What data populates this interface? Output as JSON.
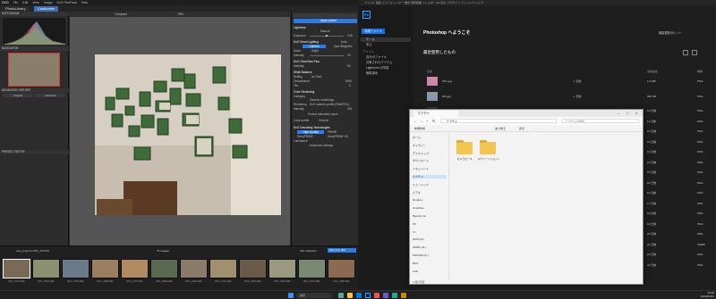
{
  "dxo": {
    "window_title": "DXO",
    "menu": [
      "File",
      "Edit",
      "View",
      "Image",
      "DxO FilmPack",
      "Help"
    ],
    "tabs": {
      "library": "PhotoLibrary",
      "customize": "Customize"
    },
    "left": {
      "histogram": "HISTOGRAM",
      "navigator": "NAVIGATOR",
      "advanced_history": "ADVANCED HISTORY",
      "preset_editor": "PRESET EDITOR",
      "nav_buttons": [
        "Original",
        "Corrected"
      ]
    },
    "viewer": {
      "compare": "Compare",
      "zoom": "75%"
    },
    "right": {
      "search": "Search",
      "lightness": "Lightness",
      "dropdown_manual": "Manual",
      "exposure": "Exposure",
      "exposure_val": "0.00",
      "smart_lighting": "DxO Smart Lighting",
      "auto": "Auto",
      "uniform": "Uniform",
      "spot": "Spot Weighted",
      "mode": "Mode",
      "mode_val": "Slight",
      "intensity": "Intensity",
      "intensity_val": "25",
      "clear_view": "DxO ClearView Plus",
      "intensity2_val": "50",
      "white_balance": "White Balance",
      "setting": "Setting",
      "setting_val": "As Shot",
      "temp": "Temperature",
      "temp_val": "5000",
      "tint": "Tint",
      "tint_val": "0",
      "color_rendering": "Color Rendering",
      "category": "Category",
      "category_val": "Generic renderings",
      "rendering": "Rendering",
      "rendering_val": "DxO camera profile (RAWTEC)",
      "intensity3_val": "100",
      "protect": "Protect saturated colors",
      "color_profile": "Color profile",
      "color_profile_val": "Generic",
      "denoising": "DxO Denoising Technologies",
      "high_quality": "High Quality",
      "prime": "PRIME",
      "deepprime": "DeepPRIME",
      "deepprime_xd": "DeepPRIME XD",
      "luminance": "Luminance",
      "advanced": "Advanced settings",
      "apply_preset": "Apply preset"
    },
    "filmstrip": {
      "path": "test_project ▸ DSC_STOCK",
      "count": "76 images",
      "project": "Tab Collection",
      "export": "Export to disk",
      "thumbs": [
        "DSC_6770.NEF",
        "DSC_5000.NEF",
        "DSC_5708.NEF",
        "DSC_2968.NEF",
        "DSC_2779.NEF",
        "DSC_9999.NEF",
        "DSC_2300.NEF",
        "DSC_1401.NEF",
        "DSC_2999.NEF",
        "DSC_3069.NEF",
        "DSC_5601.NEF",
        "DSC_4989.NEF"
      ]
    }
  },
  "ps": {
    "title_bar": "ファイル 編集 イメージ レイヤー 書式 選択範囲 フィルター 3D 表示 プラグイン ウィンドウ ヘルプ",
    "logo": "Ps",
    "nav": {
      "home": "ホーム",
      "learn": "学ぶ",
      "files": "ファイル",
      "your_files": "自分のファイル",
      "shared": "共有されたアイテム",
      "lightroom": "Lightroom の写真",
      "deleted": "削除済み"
    },
    "new_file": "新規ファイル",
    "welcome": "Photoshop へようこそ",
    "new_features": "機能更新のヒント",
    "recent": "最近使用したもの",
    "col_name": "名前",
    "col_date": "最終編集",
    "col_size": "サイズ",
    "col_type": "種類",
    "recent_files": [
      {
        "name": "003.png",
        "date": "1 日前",
        "size": "1.0 MB",
        "type": "PNG"
      },
      {
        "name": "004.jpg",
        "date": "1 日前",
        "size": "988 KB",
        "type": "PNG"
      }
    ],
    "dates": [
      "10 日前",
      "11 日前",
      "12 日前",
      "12 日前",
      "12 日前",
      "13 日前",
      "15 日前",
      "15 日前",
      "16 日前",
      "17 日前",
      "18 日前",
      "19 日前",
      "20 日前",
      "21 日前",
      "22 日前",
      "22 日前"
    ],
    "types": [
      "PNG",
      "PNG",
      "PNG",
      "PNG",
      "PNG",
      "PNG",
      "PNG",
      "PNG",
      "PNG",
      "PNG",
      "PNG",
      "PNG",
      "PNG",
      "WEBP",
      "PNG",
      "PNG"
    ]
  },
  "explorer": {
    "tab": "ピクチャ",
    "address": "ピクチャ",
    "search": "ピクチャの検索",
    "toolbar": [
      "新規作成",
      "並べ替え",
      "表示",
      "..."
    ],
    "nav": [
      "ホーム",
      "ギャラリー",
      "デスクトップ",
      "ダウンロード",
      "ドキュメント",
      "ピクチャ",
      "ミュージック",
      "ビデオ",
      "Dropbox",
      "OneDrive",
      "Bsparty Inc",
      "PC",
      "C:\\",
      "DATA (D:)",
      "WORK (E:)",
      "PRIVATE (F:)",
      "BOX",
      "LAB"
    ],
    "folders": [
      "カメラロール",
      "スクリーンショット"
    ],
    "status": "2 個の項目"
  },
  "taskbar": {
    "search": "検索",
    "time": "10:36",
    "date": "2024/03/21"
  },
  "colors": {
    "accent": "#1473e6",
    "dxo_blue": "#2d7be5",
    "folder": "#f3c651"
  }
}
